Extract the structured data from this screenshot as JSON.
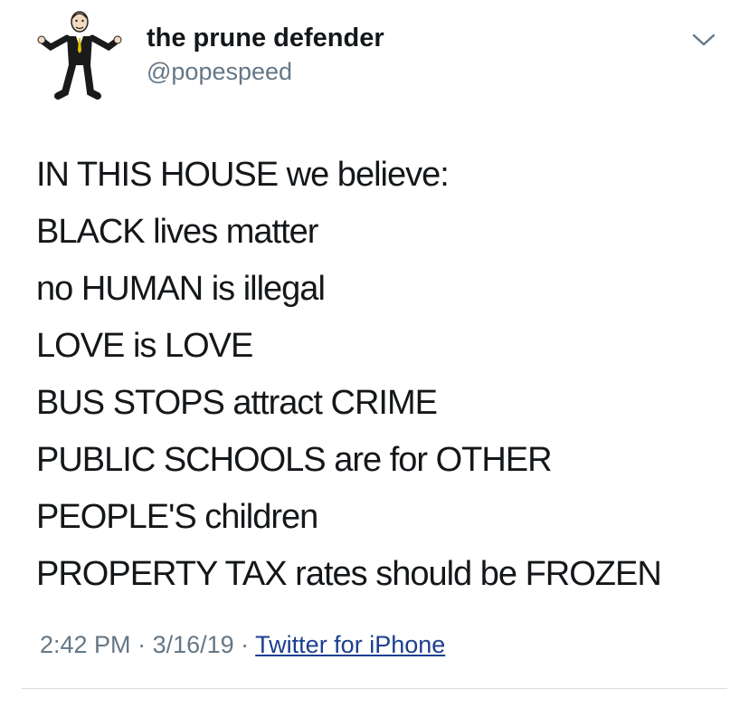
{
  "author": {
    "display_name": "the prune defender",
    "handle": "@popespeed",
    "avatar": "cartoon-man-in-suit-shrugging"
  },
  "menu": {
    "icon": "chevron-down-icon"
  },
  "tweet": {
    "lines": [
      "IN THIS HOUSE we believe:",
      "BLACK lives matter",
      "no HUMAN is illegal",
      "LOVE is LOVE",
      "BUS STOPS attract CRIME",
      "PUBLIC SCHOOLS are for OTHER",
      "PEOPLE'S children",
      "PROPERTY TAX rates should be FROZEN"
    ]
  },
  "meta": {
    "time": "2:42 PM",
    "separator": " · ",
    "date": "3/16/19",
    "source": "Twitter for iPhone"
  },
  "colors": {
    "text": "#14171a",
    "secondary": "#657786",
    "link": "#1b3f8f",
    "divider": "#d8dde1"
  }
}
